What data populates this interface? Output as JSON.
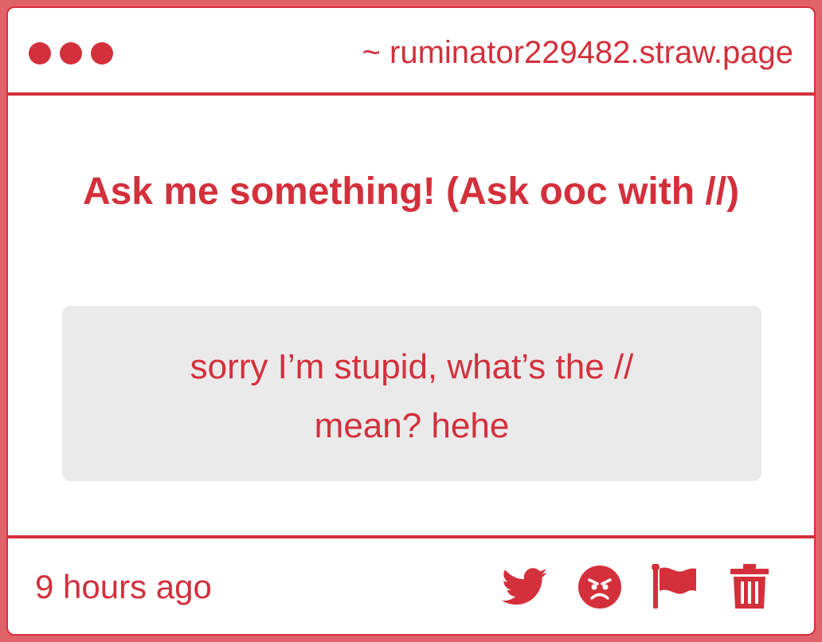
{
  "window": {
    "url": "~ ruminator229482.straw.page"
  },
  "question": {
    "prompt": "Ask me something!  (Ask ooc with //)",
    "text": "sorry I’m stupid, what’s the // mean? hehe"
  },
  "footer": {
    "timestamp": "9 hours ago",
    "actions": [
      {
        "icon": "twitter-icon"
      },
      {
        "icon": "angry-face-icon"
      },
      {
        "icon": "flag-icon"
      },
      {
        "icon": "trash-icon"
      }
    ]
  },
  "colors": {
    "accent": "#d3303b",
    "frame": "#e0636a",
    "question_bg": "#ebeaeb",
    "card_bg": "#ffffff"
  }
}
